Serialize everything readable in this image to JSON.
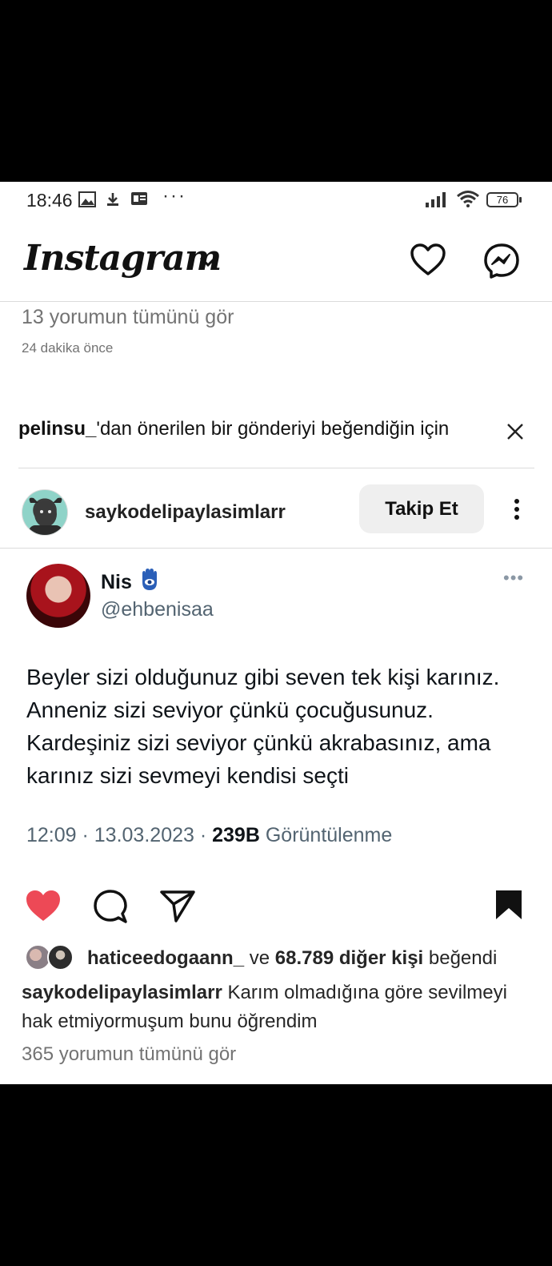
{
  "status_bar": {
    "time": "18:46",
    "battery": "76"
  },
  "header": {
    "logo": "Instagram"
  },
  "previous_post": {
    "view_comments": "13 yorumun tümünü gör",
    "time_ago": "24 dakika önce"
  },
  "suggestion": {
    "username": "pelinsu_",
    "text": "'dan önerilen bir gönderiyi beğendiğin için"
  },
  "post": {
    "username": "saykodelipaylasimlarr",
    "follow_label": "Takip Et",
    "tweet": {
      "name": "Nis",
      "handle": "@ehbenisaa",
      "text": "Beyler sizi olduğunuz gibi seven tek kişi karınız. Anneniz sizi seviyor çünkü çocuğusunuz. Kardeşiniz sizi seviyor çünkü akrabasınız, ama karınız sizi sevmeyi kendisi seçti",
      "time_date": "12:09 · 13.03.2023 · ",
      "views": "239B",
      "views_label": "Görüntülenme"
    },
    "liked_by": {
      "user": "haticeedogaann_",
      "connector": "ve",
      "others": "68.789 diğer kişi",
      "suffix": "beğendi"
    },
    "caption": {
      "username": "saykodelipaylasimlarr",
      "text": "Karım olmadığına göre sevilmeyi hak etmiyormuşum bunu öğrendim"
    },
    "view_comments": "365 yorumun tümünü gör"
  },
  "colors": {
    "like_red": "#ed4956",
    "muted": "#737373",
    "tweet_gray": "#536471",
    "hamsa_blue": "#2b5fb8"
  }
}
